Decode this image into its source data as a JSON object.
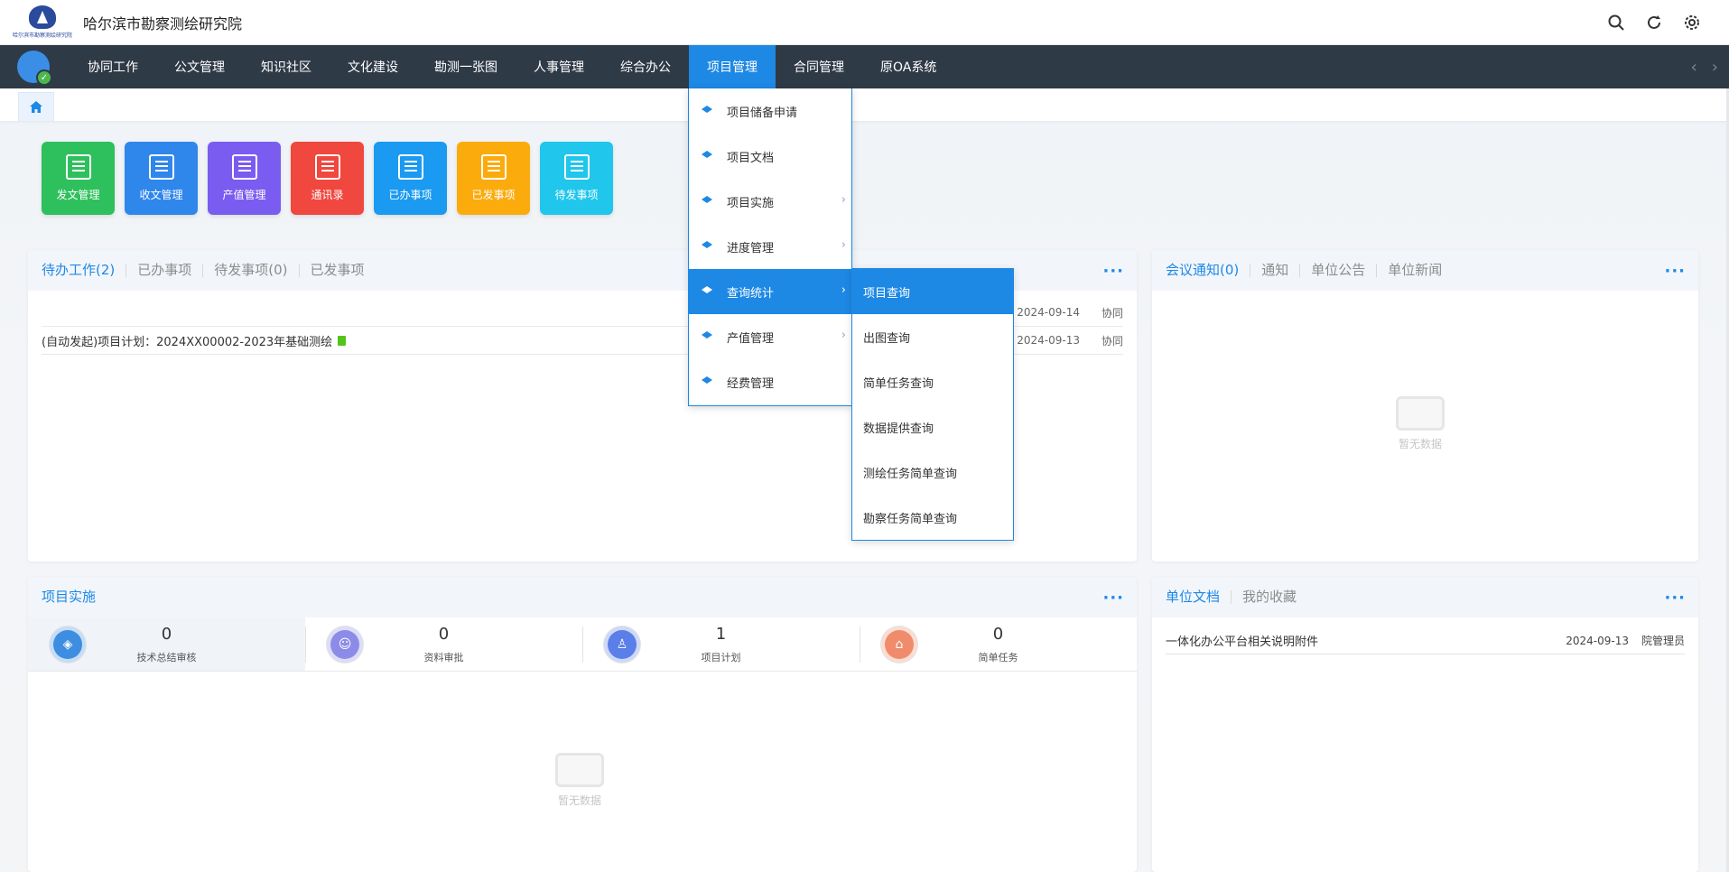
{
  "app": {
    "title": "哈尔滨市勘察测绘研究院",
    "logo_text": "哈尔滨市勘察测绘研究院"
  },
  "top_actions": [
    {
      "icon": "search-icon"
    },
    {
      "icon": "refresh-icon"
    },
    {
      "icon": "settings-icon"
    }
  ],
  "nav": {
    "items": [
      "协同工作",
      "公文管理",
      "知识社区",
      "文化建设",
      "勘测一张图",
      "人事管理",
      "综合办公",
      "项目管理",
      "合同管理",
      "原OA系统"
    ],
    "active": "项目管理",
    "prev_arrow": "‹",
    "next_arrow": "›"
  },
  "shortcuts": [
    {
      "label": "发文管理",
      "color": "#2ec05c"
    },
    {
      "label": "收文管理",
      "color": "#2f86eb"
    },
    {
      "label": "产值管理",
      "color": "#7a5cf0"
    },
    {
      "label": "通讯录",
      "color": "#f0473e"
    },
    {
      "label": "已办事项",
      "color": "#1a9af0"
    },
    {
      "label": "已发事项",
      "color": "#fbab0c"
    },
    {
      "label": "待发事项",
      "color": "#20c6ec"
    }
  ],
  "todo_panel": {
    "tabs": [
      "待办工作(2)",
      "已办事项",
      "待发事项(0)",
      "已发事项"
    ],
    "more": "···",
    "rows": [
      {
        "title": "",
        "date": "2024-09-14",
        "type": "协同"
      },
      {
        "title": "(自动发起)项目计划：2024XX00002-2023年基础测绘",
        "date": "2024-09-13",
        "type": "协同"
      }
    ],
    "partial_texts": [
      "",
      ""
    ]
  },
  "meeting_panel": {
    "tabs": [
      "会议通知(0)",
      "通知",
      "单位公告",
      "单位新闻"
    ],
    "more": "···",
    "empty_text": "暂无数据"
  },
  "project_panel": {
    "title": "项目实施",
    "more": "···",
    "stats": [
      {
        "value": "0",
        "label": "技术总结审核",
        "color": "#3d8de0"
      },
      {
        "value": "0",
        "label": "资料审批",
        "color": "#8c8ce8"
      },
      {
        "value": "1",
        "label": "项目计划",
        "color": "#5b7fe8"
      },
      {
        "value": "0",
        "label": "简单任务",
        "color": "#f08c6c"
      }
    ],
    "empty_text": "暂无数据"
  },
  "docs_panel": {
    "tabs": [
      "单位文档",
      "我的收藏"
    ],
    "more": "···",
    "rows": [
      {
        "title": "一体化办公平台相关说明附件",
        "date": "2024-09-13",
        "author": "院管理员"
      }
    ]
  },
  "menu": {
    "items": [
      {
        "label": "项目储备申请",
        "has_sub": false
      },
      {
        "label": "项目文档",
        "has_sub": false
      },
      {
        "label": "项目实施",
        "has_sub": true
      },
      {
        "label": "进度管理",
        "has_sub": true
      },
      {
        "label": "查询统计",
        "has_sub": true,
        "active": true
      },
      {
        "label": "产值管理",
        "has_sub": true
      },
      {
        "label": "经费管理",
        "has_sub": false
      }
    ],
    "submenu": [
      "项目查询",
      "出图查询",
      "简单任务查询",
      "数据提供查询",
      "测绘任务简单查询",
      "勘察任务简单查询"
    ],
    "submenu_active": "项目查询"
  }
}
